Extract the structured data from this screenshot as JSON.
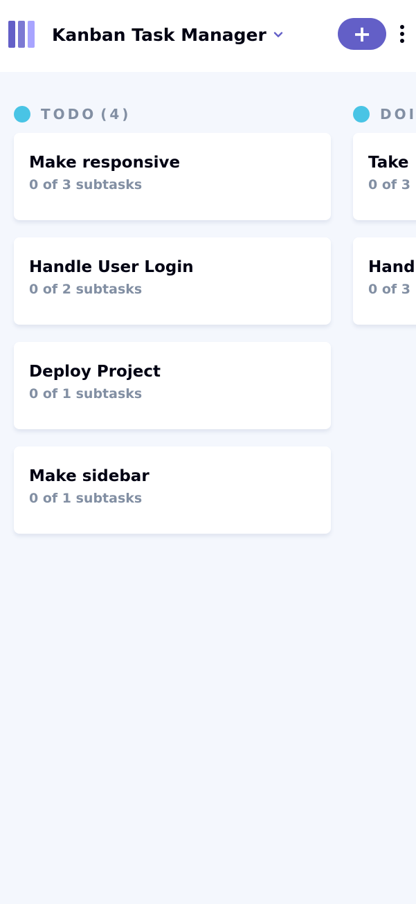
{
  "header": {
    "board_title": "Kanban Task Manager",
    "add_task_label": "+"
  },
  "columns": [
    {
      "name": "TODO",
      "count": "(4)",
      "color": "#49C4E5",
      "tasks": [
        {
          "title": "Make responsive",
          "subtasks": "0 of 3 subtasks"
        },
        {
          "title": "Handle User Login",
          "subtasks": "0 of 2 subtasks"
        },
        {
          "title": "Deploy Project",
          "subtasks": "0 of 1 subtasks"
        },
        {
          "title": "Make sidebar",
          "subtasks": "0 of 1 subtasks"
        }
      ]
    },
    {
      "name": "DOING",
      "color": "#49C4E5",
      "tasks": [
        {
          "title": "Take",
          "subtasks": "0 of 3"
        },
        {
          "title": "Hand",
          "subtasks": "0 of 3"
        }
      ]
    }
  ],
  "colors": {
    "accent": "#635FC7",
    "background": "#F4F7FD",
    "muted_text": "#828FA3",
    "column_dot": "#49C4E5"
  },
  "icons": {
    "logo": "kanban-logo-icon",
    "dropdown": "chevron-down-icon",
    "add": "plus-icon",
    "menu": "vertical-ellipsis-icon"
  }
}
